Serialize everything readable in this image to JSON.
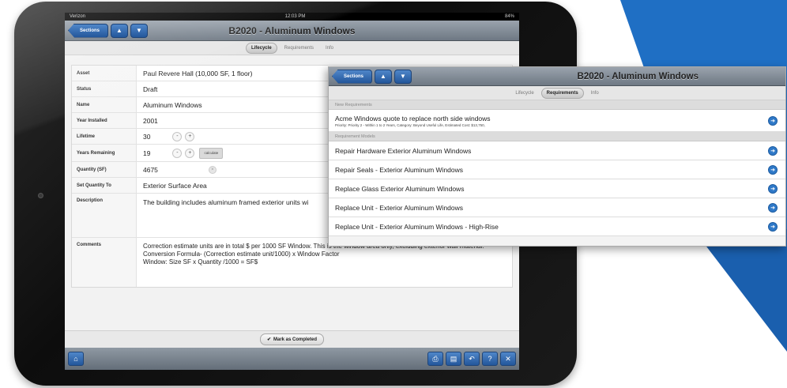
{
  "colors": {
    "accent_blue": "#1f6fc4",
    "nav_gradient": "#7d8791",
    "button_blue": "#2f6db5"
  },
  "status_bar": {
    "carrier": "Verizon",
    "time": "12:03 PM",
    "battery": "84%"
  },
  "main": {
    "nav": {
      "sections_label": "Sections",
      "title": "B2020 - Aluminum Windows"
    },
    "tabs": [
      "Lifecycle",
      "Requirements",
      "Info"
    ],
    "fields": [
      {
        "label": "Asset",
        "value": "Paul Revere Hall (10,000 SF, 1 floor)"
      },
      {
        "label": "Status",
        "value": "Draft"
      },
      {
        "label": "Name",
        "value": "Aluminum Windows"
      },
      {
        "label": "Year Installed",
        "value": "2001"
      },
      {
        "label": "Lifetime",
        "value": "30"
      },
      {
        "label": "Years Remaining",
        "value": "19"
      },
      {
        "label": "Quantity (SF)",
        "value": "4675"
      },
      {
        "label": "Set Quantity To",
        "value": "Exterior Surface Area"
      },
      {
        "label": "Description",
        "value": "The building includes aluminum framed exterior units wi"
      },
      {
        "label": "Comments",
        "value": "Correction estimate units are in total $ per 1000 SF Window. This is the window area only, excluding exterior wall material.\nConversion Formula- (Correction estimate unit/1000) x Window Factor\nWindow: Size SF x Quantity /1000 = SF$"
      }
    ],
    "calculate_label": "calculate",
    "mark_completed_label": "Mark as Completed",
    "icons": {
      "home": "home-icon",
      "print": "print-icon",
      "doc": "document-icon",
      "undo": "undo-icon",
      "help": "help-icon",
      "tools": "tools-icon"
    },
    "help_glyph": "?"
  },
  "overlay": {
    "nav": {
      "sections_label": "Sections",
      "title": "B2020 - Aluminum Windows"
    },
    "tabs": [
      "Lifecycle",
      "Requirements",
      "Info"
    ],
    "new_requirements_header": "New Requirements",
    "new_requirements": [
      {
        "title": "Acme Windows quote to replace north side windows",
        "subtitle": "Priority: Priority 2 - Within 1 to 2 Years, Category: Beyond Useful Life, Estimated Cost: $13,750,"
      }
    ],
    "models_header": "Requirement Models",
    "models": [
      "Repair Hardware Exterior Aluminum Windows",
      "Repair Seals - Exterior Aluminum Windows",
      "Replace Glass Exterior Aluminum Windows",
      "Replace Unit - Exterior Aluminum Windows",
      "Replace Unit - Exterior Aluminum Windows - High-Rise"
    ]
  }
}
